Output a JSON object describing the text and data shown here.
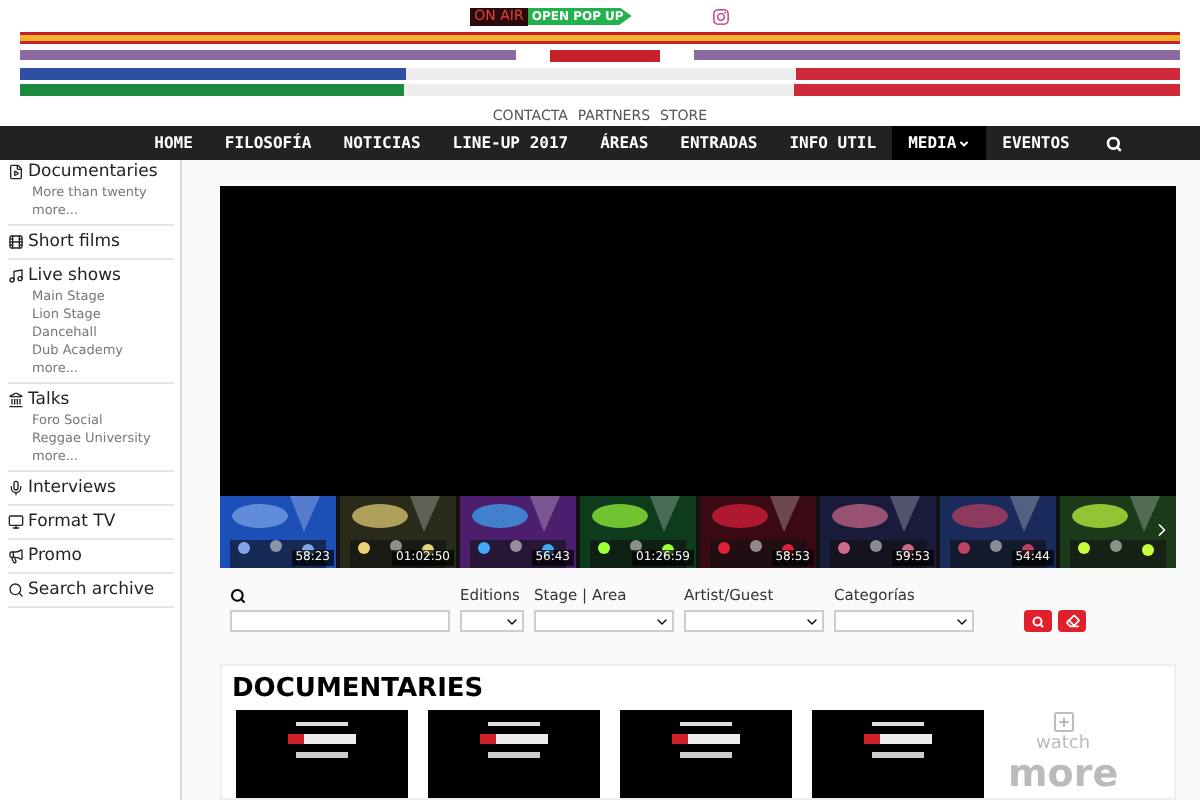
{
  "header": {
    "on_air": "ON AIR",
    "popup_button": "OPEN POP UP",
    "links": [
      "CONTACTA",
      "PARTNERS",
      "STORE"
    ]
  },
  "nav": [
    {
      "label": "HOME",
      "selected": false
    },
    {
      "label": "FILOSOFÍA",
      "selected": false
    },
    {
      "label": "NOTICIAS",
      "selected": false
    },
    {
      "label": "LINE-UP 2017",
      "selected": false
    },
    {
      "label": "ÁREAS",
      "selected": false
    },
    {
      "label": "ENTRADAS",
      "selected": false
    },
    {
      "label": "INFO UTIL",
      "selected": false
    },
    {
      "label": "MEDIA",
      "selected": true,
      "dropdown": true
    },
    {
      "label": "EVENTOS",
      "selected": false
    }
  ],
  "sidebar": [
    {
      "kind": "documentary",
      "label": "Documentaries",
      "children": [
        "More than twenty",
        "more..."
      ]
    },
    {
      "kind": "film",
      "label": "Short films"
    },
    {
      "kind": "music",
      "label": "Live shows",
      "children": [
        "Main Stage",
        "Lion Stage",
        "Dancehall",
        "Dub Academy",
        "more..."
      ]
    },
    {
      "kind": "talk",
      "label": "Talks",
      "children": [
        "Foro Social",
        "Reggae University",
        "more..."
      ]
    },
    {
      "kind": "mic",
      "label": "Interviews"
    },
    {
      "kind": "tv",
      "label": "Format TV"
    },
    {
      "kind": "promo",
      "label": "Promo"
    },
    {
      "kind": "search",
      "label": "Search archive"
    }
  ],
  "thumbnails": [
    {
      "kind": "picture",
      "duration": "58:23"
    },
    {
      "kind": "picture",
      "duration": "01:02:50"
    },
    {
      "kind": "picture",
      "duration": "56:43"
    },
    {
      "kind": "picture",
      "duration": "01:26:59"
    },
    {
      "kind": "picture",
      "duration": "58:53"
    },
    {
      "kind": "picture",
      "duration": "59:53"
    },
    {
      "kind": "picture",
      "duration": "54:44"
    },
    {
      "kind": "picture"
    }
  ],
  "filters": [
    {
      "label": "Editions"
    },
    {
      "label": "Stage | Area"
    },
    {
      "label": "Artist/Guest"
    },
    {
      "label": "Categorías"
    }
  ],
  "documentaries": {
    "title": "DOCUMENTARIES",
    "cards": [
      {
        "kind": "picture"
      },
      {
        "kind": "picture"
      },
      {
        "kind": "picture"
      },
      {
        "kind": "picture"
      }
    ],
    "more": [
      "watch",
      "more"
    ]
  }
}
